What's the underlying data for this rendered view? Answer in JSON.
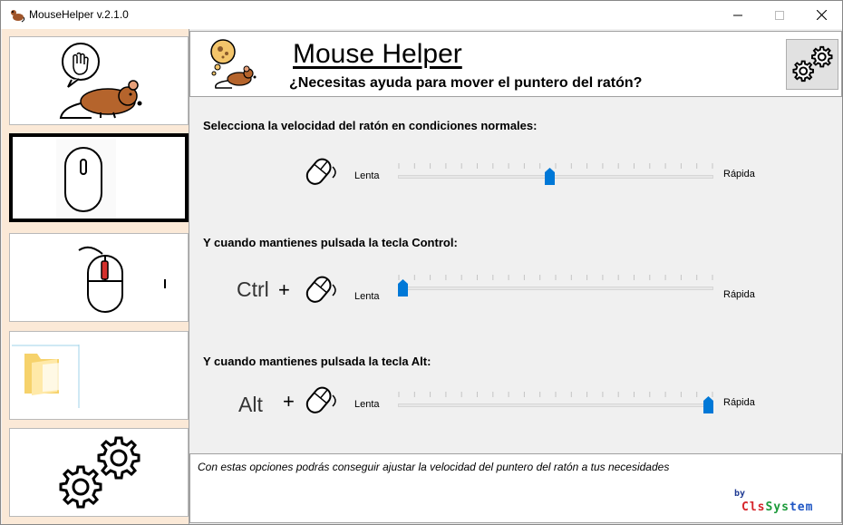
{
  "window": {
    "title": "MouseHelper v.2.1.0",
    "controls": {
      "minimize_icon": "minimize-icon",
      "maximize_icon": "maximize-icon",
      "close_icon": "close-icon"
    }
  },
  "sidebar": {
    "items": [
      {
        "name": "help",
        "icon": "mouse-with-hand-bubble-icon"
      },
      {
        "name": "speed",
        "icon": "computer-mouse-icon",
        "selected": true
      },
      {
        "name": "scroll",
        "icon": "mouse-scroll-wheel-icon"
      },
      {
        "name": "files",
        "icon": "folder-icon"
      },
      {
        "name": "settings",
        "icon": "gears-icon"
      }
    ]
  },
  "header": {
    "title": "Mouse Helper",
    "subtitle": "¿Necesitas ayuda para mover el puntero del ratón?",
    "settings_icon": "gears-icon"
  },
  "sections": [
    {
      "label": "Selecciona la velocidad del ratón en condiciones normales:",
      "key": "",
      "plus": "",
      "min_label": "Lenta",
      "max_label": "Rápida",
      "value": 0.48
    },
    {
      "label": "Y cuando mantienes pulsada la tecla Control:",
      "key": "Ctrl",
      "plus": "+",
      "min_label": "Lenta",
      "max_label": "Rápida",
      "value": 0.0
    },
    {
      "label": "Y cuando mantienes pulsada la tecla Alt:",
      "key": "Alt",
      "plus": "+",
      "min_label": "Lenta",
      "max_label": "Rápida",
      "value": 1.0
    }
  ],
  "footer": {
    "text": "Con estas opciones podrás conseguir ajustar la velocidad del puntero del ratón a tus necesidades",
    "brand_by": "by",
    "brand_part1": "Cls",
    "brand_part2": "Sys",
    "brand_part3": "tem"
  },
  "colors": {
    "accent": "#0078d7",
    "sidebar_bg": "#fbe9d7",
    "brand_red": "#d6252b",
    "brand_green": "#1c9a3a",
    "brand_blue": "#1f56c4"
  }
}
